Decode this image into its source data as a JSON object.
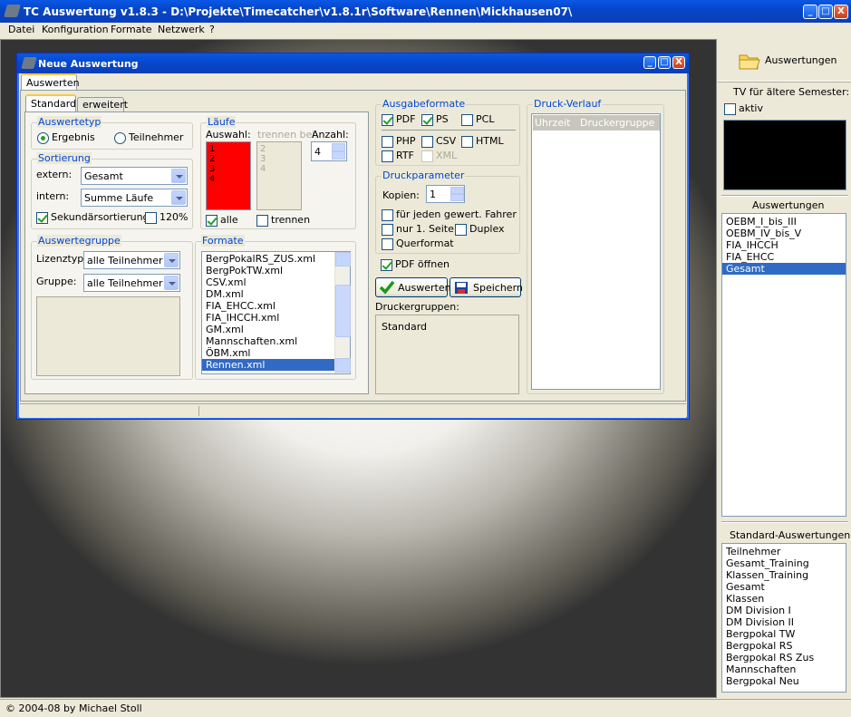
{
  "app": {
    "title": "TC Auswertung v1.8.3 - D:\\Projekte\\Timecatcher\\v1.8.1r\\Software\\Rennen\\Mickhausen07\\",
    "menu": [
      "Datei",
      "Konfiguration",
      "Formate",
      "Netzwerk",
      "?"
    ],
    "status": "© 2004-08 by Michael Stoll"
  },
  "window_buttons": {
    "minimize": "_",
    "maximize": "□",
    "close": "X"
  },
  "right_panel": {
    "auswertungen_button": "Auswertungen",
    "tv_label": "TV für ältere Semester:",
    "tv_checkbox": "aktiv",
    "auswertungen_heading": "Auswertungen",
    "auswertungen_items": [
      "OEBM_I_bis_III",
      "OEBM_IV_bis_V",
      "FIA_IHCCH",
      "FIA_EHCC",
      "Gesamt"
    ],
    "auswertungen_selected": 4,
    "standard_heading": "Standard-Auswertungen",
    "standard_items": [
      "Teilnehmer",
      "Gesamt_Training",
      "Klassen_Training",
      "Gesamt",
      "Klassen",
      "DM Division I",
      "DM Division II",
      "Bergpokal TW",
      "Bergpokal RS",
      "Bergpokal RS Zus",
      "Mannschaften",
      "Bergpokal Neu"
    ]
  },
  "dialog": {
    "title": "Neue Auswertung",
    "outer_tab": "Auswerten",
    "tabs": [
      "Standard",
      "erweitert"
    ],
    "auswertetyp": {
      "title": "Auswertetyp",
      "options": [
        "Ergebnis",
        "Teilnehmer"
      ],
      "selected": 0
    },
    "sortierung": {
      "title": "Sortierung",
      "extern_label": "extern:",
      "extern_value": "Gesamt",
      "intern_label": "intern:",
      "intern_value": "Summe Läufe",
      "sekundaer": "Sekundärsortierung",
      "prozent": "120%"
    },
    "laeufe": {
      "title": "Läufe",
      "auswahl_label": "Auswahl:",
      "trennen_label": "trennen bei:",
      "anzahl_label": "Anzahl:",
      "auswahl_items": [
        "1",
        "2",
        "3",
        "4"
      ],
      "trennen_items": [
        "2",
        "3",
        "4"
      ],
      "anzahl_value": "4",
      "alle": "alle",
      "trennen": "trennen",
      "selected_color": "#ff0000"
    },
    "auswertegruppe": {
      "title": "Auswertegruppe",
      "lizenztyp_label": "Lizenztyp:",
      "lizenztyp_value": "alle Teilnehmer",
      "gruppe_label": "Gruppe:",
      "gruppe_value": "alle Teilnehmer"
    },
    "formate": {
      "title": "Formate",
      "items": [
        "BergPokalRS_ZUS.xml",
        "BergPokTW.xml",
        "CSV.xml",
        "DM.xml",
        "FIA_EHCC.xml",
        "FIA_IHCCH.xml",
        "GM.xml",
        "Mannschaften.xml",
        "ÖBM.xml",
        "Rennen.xml"
      ],
      "selected": 9
    },
    "ausgabeformate": {
      "title": "Ausgabeformate",
      "pdf": "PDF",
      "ps": "PS",
      "pcl": "PCL",
      "php": "PHP",
      "csv": "CSV",
      "html": "HTML",
      "rtf": "RTF",
      "xml": "XML"
    },
    "druckparameter": {
      "title": "Druckparameter",
      "kopien_label": "Kopien:",
      "kopien_value": "1",
      "jeden_fahrer": "für jeden gewert. Fahrer",
      "nur_seite": "nur 1. Seite",
      "duplex": "Duplex",
      "querformat": "Querformat"
    },
    "pdf_oeffnen": "PDF öffnen",
    "auswerten_button": "Auswerten",
    "speichern_button": "Speichern",
    "druckergruppen_label": "Druckergruppen:",
    "druckergruppen_items": [
      "Standard"
    ],
    "druck_verlauf": {
      "title": "Druck-Verlauf",
      "col_uhrzeit": "Uhrzeit",
      "col_druckergruppe": "Druckergruppe"
    }
  },
  "colors": {
    "accent": "#316ac5",
    "group_title": "#0046d5",
    "titlebar": "#0a58e6"
  }
}
